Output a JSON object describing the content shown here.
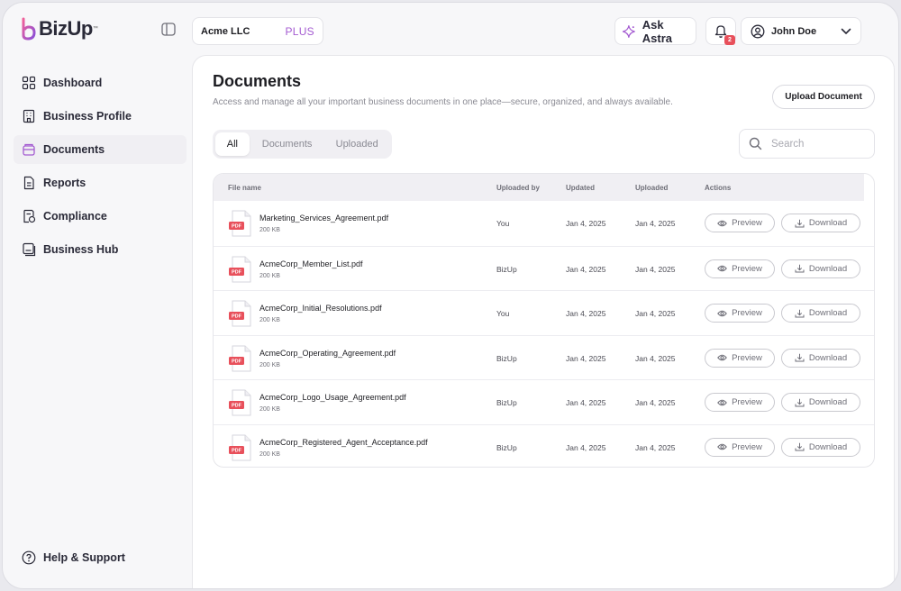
{
  "brand": {
    "name": "BizUp",
    "tm": "™",
    "accent": "#a45bd1"
  },
  "header": {
    "company": {
      "name": "Acme LLC",
      "plan": "PLUS"
    },
    "ask_label": "Ask Astra",
    "notifications_badge": "2",
    "user_name": "John Doe"
  },
  "sidebar": {
    "items": [
      {
        "label": "Dashboard",
        "icon": "grid-icon"
      },
      {
        "label": "Business Profile",
        "icon": "building-icon"
      },
      {
        "label": "Documents",
        "icon": "folder-icon"
      },
      {
        "label": "Reports",
        "icon": "report-icon"
      },
      {
        "label": "Compliance",
        "icon": "compliance-icon"
      },
      {
        "label": "Business Hub",
        "icon": "hub-icon"
      }
    ],
    "active_index": 2,
    "help_label": "Help & Support"
  },
  "main": {
    "title": "Documents",
    "subtitle": "Access and manage all your important business documents in one place—secure, organized, and always available.",
    "upload_label": "Upload Document",
    "tabs": [
      {
        "label": "All",
        "active": true
      },
      {
        "label": "Documents",
        "active": false
      },
      {
        "label": "Uploaded",
        "active": false
      }
    ],
    "search": {
      "placeholder": "Search",
      "value": ""
    },
    "table": {
      "headers": [
        "File name",
        "Uploaded by",
        "Updated",
        "Uploaded",
        "Actions"
      ],
      "preview_label": "Preview",
      "download_label": "Download",
      "file_badge": "PDF",
      "rows": [
        {
          "name": "Marketing_Services_Agreement.pdf",
          "size": "200 KB",
          "uploaded_by": "You",
          "updated": "Jan 4, 2025",
          "uploaded": "Jan 4, 2025"
        },
        {
          "name": "AcmeCorp_Member_List.pdf",
          "size": "200 KB",
          "uploaded_by": "BizUp",
          "updated": "Jan 4, 2025",
          "uploaded": "Jan 4, 2025"
        },
        {
          "name": "AcmeCorp_Initial_Resolutions.pdf",
          "size": "200 KB",
          "uploaded_by": "You",
          "updated": "Jan 4, 2025",
          "uploaded": "Jan 4, 2025"
        },
        {
          "name": "AcmeCorp_Operating_Agreement.pdf",
          "size": "200 KB",
          "uploaded_by": "BizUp",
          "updated": "Jan 4, 2025",
          "uploaded": "Jan 4, 2025"
        },
        {
          "name": "AcmeCorp_Logo_Usage_Agreement.pdf",
          "size": "200 KB",
          "uploaded_by": "BizUp",
          "updated": "Jan 4, 2025",
          "uploaded": "Jan 4, 2025"
        },
        {
          "name": "AcmeCorp_Registered_Agent_Acceptance.pdf",
          "size": "200 KB",
          "uploaded_by": "BizUp",
          "updated": "Jan 4, 2025",
          "uploaded": "Jan 4, 2025"
        }
      ]
    }
  }
}
